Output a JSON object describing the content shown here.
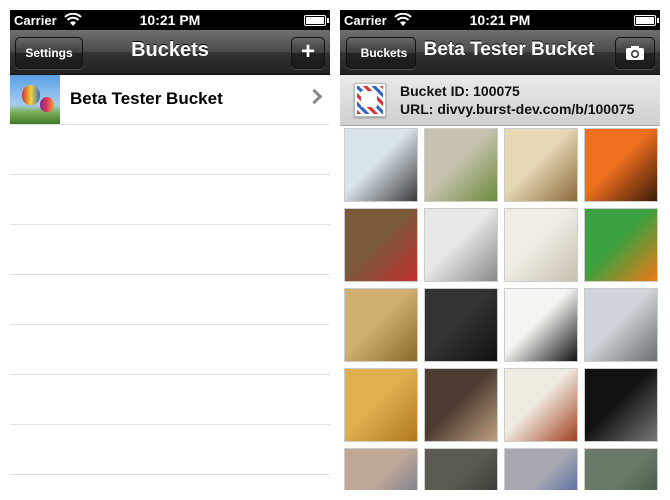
{
  "status": {
    "carrier": "Carrier",
    "time": "10:21 PM"
  },
  "left": {
    "nav": {
      "title": "Buckets",
      "settings_label": "Settings",
      "add_label": "+"
    },
    "buckets": [
      {
        "name": "Beta Tester Bucket"
      }
    ],
    "empty_rows": 7
  },
  "right": {
    "nav": {
      "title": "Beta Tester Bucket",
      "back_label": "Buckets"
    },
    "info": {
      "bucket_id": "Bucket ID: 100075",
      "url": "URL: divvy.burst-dev.com/b/100075"
    },
    "photos": [
      {
        "name": "photo-computer-desk",
        "colors": [
          "#d9e3ea",
          "#3a3a3a"
        ]
      },
      {
        "name": "photo-salad-bowl",
        "colors": [
          "#c7c2b0",
          "#6a8c3a"
        ]
      },
      {
        "name": "photo-noodle-soup",
        "colors": [
          "#e6d7b5",
          "#8a6a3a"
        ]
      },
      {
        "name": "photo-sunset",
        "colors": [
          "#f07020",
          "#3a1a08"
        ]
      },
      {
        "name": "photo-child-with-toy",
        "colors": [
          "#7a5a3a",
          "#c03030"
        ]
      },
      {
        "name": "photo-drawing",
        "colors": [
          "#e8e8e8",
          "#888"
        ]
      },
      {
        "name": "photo-eggs",
        "colors": [
          "#f0ede5",
          "#c8c0ae"
        ]
      },
      {
        "name": "photo-clownfish",
        "colors": [
          "#3aa040",
          "#f07818"
        ]
      },
      {
        "name": "photo-gadget-box",
        "colors": [
          "#d0b070",
          "#8a6a2a"
        ]
      },
      {
        "name": "photo-smartphone",
        "colors": [
          "#333",
          "#111"
        ]
      },
      {
        "name": "photo-pen-on-paper",
        "colors": [
          "#f4f4f0",
          "#111"
        ]
      },
      {
        "name": "photo-railway",
        "colors": [
          "#cfd5da",
          "#6a7070"
        ]
      },
      {
        "name": "photo-wood-door",
        "colors": [
          "#e0b050",
          "#b07820"
        ]
      },
      {
        "name": "photo-people-office",
        "colors": [
          "#4a3a30",
          "#c0a080"
        ]
      },
      {
        "name": "photo-food-plates",
        "colors": [
          "#f0ebe0",
          "#a04020"
        ]
      },
      {
        "name": "photo-teamwork-poster",
        "colors": [
          "#111",
          "#777"
        ]
      },
      {
        "name": "photo-baby",
        "colors": [
          "#c0a898",
          "#5a6a8a"
        ]
      },
      {
        "name": "photo-backpack",
        "colors": [
          "#5a5a50",
          "#2a2a28"
        ]
      },
      {
        "name": "photo-street",
        "colors": [
          "#a8a8b0",
          "#3050a0"
        ]
      },
      {
        "name": "photo-green-fabric",
        "colors": [
          "#6a7a68",
          "#3a4a3a"
        ]
      }
    ]
  },
  "colors": {
    "nav_dark": "#222222",
    "row_divider": "#e0e0e0"
  }
}
